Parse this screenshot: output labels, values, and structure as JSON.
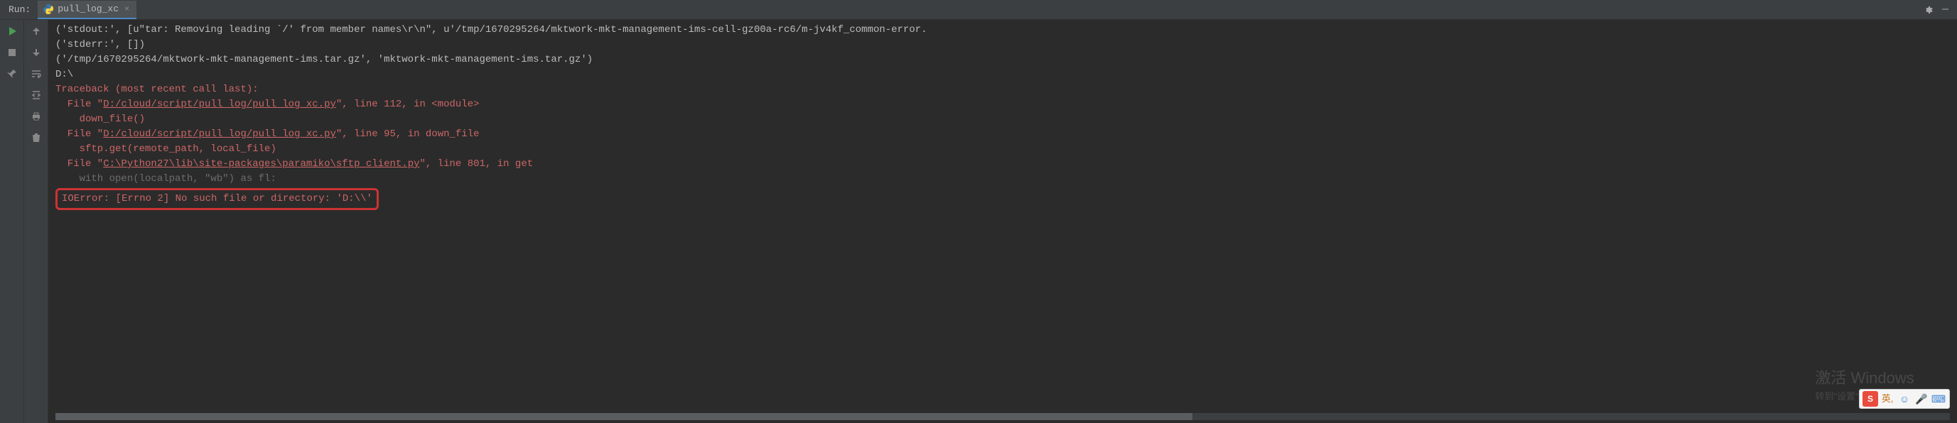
{
  "tabBar": {
    "runLabel": "Run:",
    "tabName": "pull_log_xc"
  },
  "console": {
    "lines": [
      {
        "cls": "c-white",
        "text": "('stdout:', [u\"tar: Removing leading `/' from member names\\r\\n\", u'/tmp/1670295264/mktwork-mkt-management-ims-cell-gz00a-rc6/m-jv4kf_common-error."
      },
      {
        "cls": "c-white",
        "text": "('stderr:', [])"
      },
      {
        "cls": "c-white",
        "text": "('/tmp/1670295264/mktwork-mkt-management-ims.tar.gz', 'mktwork-mkt-management-ims.tar.gz')"
      },
      {
        "cls": "c-white",
        "text": "D:\\"
      }
    ],
    "traceback": {
      "header": "Traceback (most recent call last):",
      "frames": [
        {
          "prefix": "  File \"",
          "path": "D:/cloud/script/pull_log/pull_log_xc.py",
          "suffix": "\", line 112, in <module>",
          "code": "    down_file()"
        },
        {
          "prefix": "  File \"",
          "path": "D:/cloud/script/pull_log/pull_log_xc.py",
          "suffix": "\", line 95, in down_file",
          "code": "    sftp.get(remote_path, local_file)"
        },
        {
          "prefix": "  File \"",
          "path": "C:\\Python27\\lib\\site-packages\\paramiko\\sftp_client.py",
          "suffix": "\", line 801, in get",
          "code": "    with open(localpath, \"wb\") as fl:"
        }
      ],
      "error": "IOError: [Errno 2] No such file or directory: 'D:\\\\'"
    }
  },
  "watermark": {
    "line1": "激活 Windows",
    "line2": "转到\"设置\"以激活 Windows。"
  },
  "ime": {
    "sogou": "S",
    "lang": "英,",
    "smile": "☺",
    "mic": "🎤",
    "kbd": "⌨"
  }
}
